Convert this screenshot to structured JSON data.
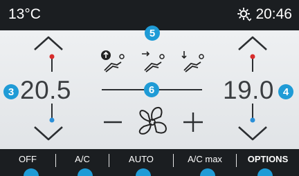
{
  "status_bar": {
    "outside_temp": "13°C",
    "time": "20:46",
    "icon": "sun-settings-icon"
  },
  "left_zone": {
    "temperature": "20.5",
    "callout": "3"
  },
  "right_zone": {
    "temperature": "19.0",
    "callout": "4"
  },
  "air_distribution": {
    "callout": "5",
    "modes": [
      "distribution-head-icon",
      "distribution-body-icon",
      "distribution-feet-icon"
    ]
  },
  "fan": {
    "callout": "6",
    "minus": "–",
    "plus": "+"
  },
  "bottom_buttons": [
    {
      "label": "OFF",
      "bold": false
    },
    {
      "label": "A/C",
      "bold": false
    },
    {
      "label": "AUTO",
      "bold": false
    },
    {
      "label": "A/C max",
      "bold": false
    },
    {
      "label": "OPTIONS",
      "bold": true
    }
  ],
  "colors": {
    "badge": "#1f9bd6",
    "hot": "#d82c2c",
    "cold": "#2a8fd8",
    "bar": "#1b1e21"
  }
}
